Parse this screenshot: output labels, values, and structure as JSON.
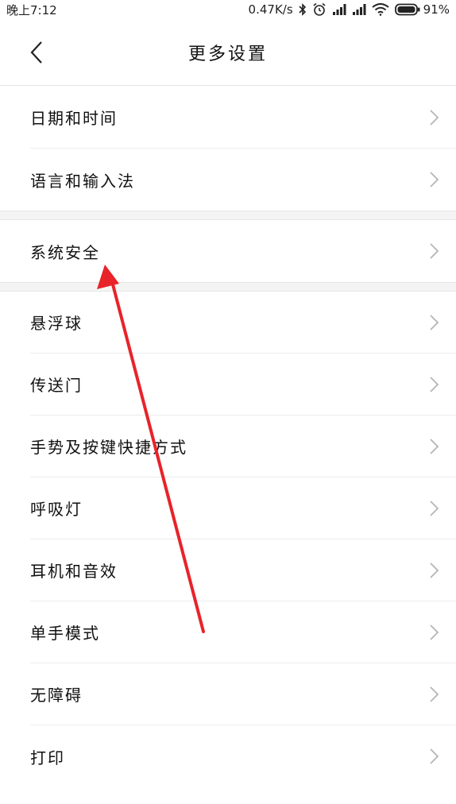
{
  "status_bar": {
    "time": "晚上7:12",
    "network_speed": "0.47K/s",
    "battery_percent": "91%",
    "icons": [
      "bluetooth-icon",
      "alarm-icon",
      "signal-icon",
      "signal-icon",
      "wifi-icon",
      "battery-icon"
    ]
  },
  "header": {
    "title": "更多设置",
    "back_icon": "chevron-left-icon"
  },
  "groups": [
    {
      "items": [
        {
          "label": "日期和时间"
        },
        {
          "label": "语言和输入法"
        }
      ]
    },
    {
      "items": [
        {
          "label": "系统安全"
        }
      ]
    },
    {
      "items": [
        {
          "label": "悬浮球"
        },
        {
          "label": "传送门"
        },
        {
          "label": "手势及按键快捷方式"
        },
        {
          "label": "呼吸灯"
        },
        {
          "label": "耳机和音效"
        },
        {
          "label": "单手模式"
        },
        {
          "label": "无障碍"
        },
        {
          "label": "打印"
        }
      ]
    }
  ],
  "colors": {
    "background": "#ffffff",
    "divider": "#ececec",
    "group_gap": "#f4f4f4",
    "chevron": "#b5b5b5",
    "annotation_arrow": "#e8232a"
  }
}
